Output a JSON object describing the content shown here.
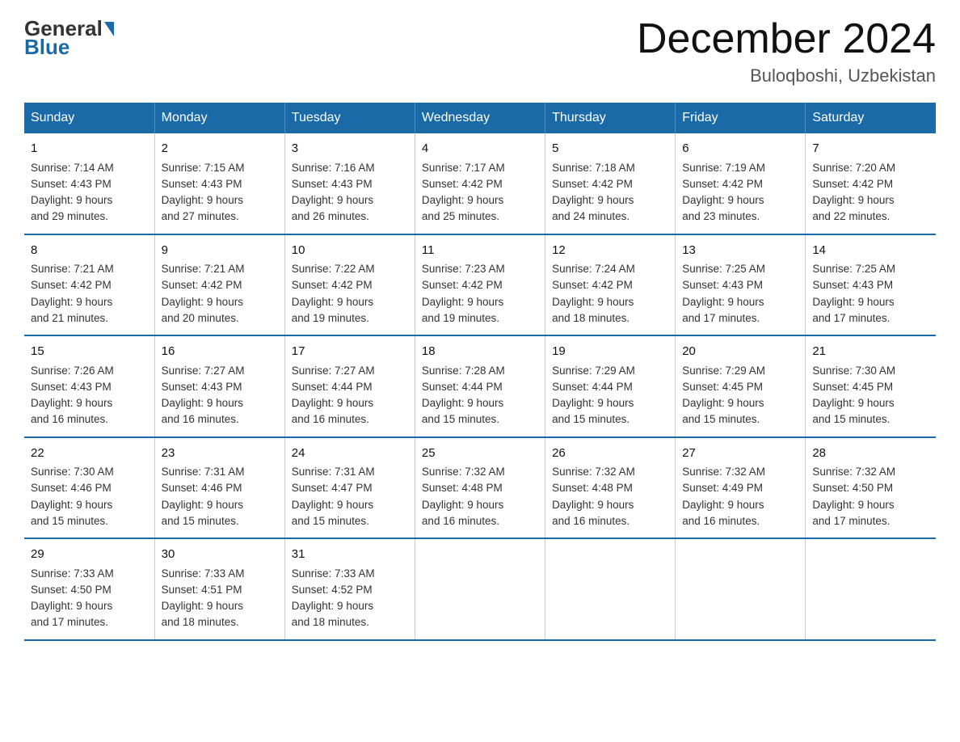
{
  "header": {
    "logo_general": "General",
    "logo_blue": "Blue",
    "title": "December 2024",
    "subtitle": "Buloqboshi, Uzbekistan"
  },
  "days_of_week": [
    "Sunday",
    "Monday",
    "Tuesday",
    "Wednesday",
    "Thursday",
    "Friday",
    "Saturday"
  ],
  "weeks": [
    [
      {
        "day": "1",
        "sunrise": "7:14 AM",
        "sunset": "4:43 PM",
        "daylight": "9 hours and 29 minutes."
      },
      {
        "day": "2",
        "sunrise": "7:15 AM",
        "sunset": "4:43 PM",
        "daylight": "9 hours and 27 minutes."
      },
      {
        "day": "3",
        "sunrise": "7:16 AM",
        "sunset": "4:43 PM",
        "daylight": "9 hours and 26 minutes."
      },
      {
        "day": "4",
        "sunrise": "7:17 AM",
        "sunset": "4:42 PM",
        "daylight": "9 hours and 25 minutes."
      },
      {
        "day": "5",
        "sunrise": "7:18 AM",
        "sunset": "4:42 PM",
        "daylight": "9 hours and 24 minutes."
      },
      {
        "day": "6",
        "sunrise": "7:19 AM",
        "sunset": "4:42 PM",
        "daylight": "9 hours and 23 minutes."
      },
      {
        "day": "7",
        "sunrise": "7:20 AM",
        "sunset": "4:42 PM",
        "daylight": "9 hours and 22 minutes."
      }
    ],
    [
      {
        "day": "8",
        "sunrise": "7:21 AM",
        "sunset": "4:42 PM",
        "daylight": "9 hours and 21 minutes."
      },
      {
        "day": "9",
        "sunrise": "7:21 AM",
        "sunset": "4:42 PM",
        "daylight": "9 hours and 20 minutes."
      },
      {
        "day": "10",
        "sunrise": "7:22 AM",
        "sunset": "4:42 PM",
        "daylight": "9 hours and 19 minutes."
      },
      {
        "day": "11",
        "sunrise": "7:23 AM",
        "sunset": "4:42 PM",
        "daylight": "9 hours and 19 minutes."
      },
      {
        "day": "12",
        "sunrise": "7:24 AM",
        "sunset": "4:42 PM",
        "daylight": "9 hours and 18 minutes."
      },
      {
        "day": "13",
        "sunrise": "7:25 AM",
        "sunset": "4:43 PM",
        "daylight": "9 hours and 17 minutes."
      },
      {
        "day": "14",
        "sunrise": "7:25 AM",
        "sunset": "4:43 PM",
        "daylight": "9 hours and 17 minutes."
      }
    ],
    [
      {
        "day": "15",
        "sunrise": "7:26 AM",
        "sunset": "4:43 PM",
        "daylight": "9 hours and 16 minutes."
      },
      {
        "day": "16",
        "sunrise": "7:27 AM",
        "sunset": "4:43 PM",
        "daylight": "9 hours and 16 minutes."
      },
      {
        "day": "17",
        "sunrise": "7:27 AM",
        "sunset": "4:44 PM",
        "daylight": "9 hours and 16 minutes."
      },
      {
        "day": "18",
        "sunrise": "7:28 AM",
        "sunset": "4:44 PM",
        "daylight": "9 hours and 15 minutes."
      },
      {
        "day": "19",
        "sunrise": "7:29 AM",
        "sunset": "4:44 PM",
        "daylight": "9 hours and 15 minutes."
      },
      {
        "day": "20",
        "sunrise": "7:29 AM",
        "sunset": "4:45 PM",
        "daylight": "9 hours and 15 minutes."
      },
      {
        "day": "21",
        "sunrise": "7:30 AM",
        "sunset": "4:45 PM",
        "daylight": "9 hours and 15 minutes."
      }
    ],
    [
      {
        "day": "22",
        "sunrise": "7:30 AM",
        "sunset": "4:46 PM",
        "daylight": "9 hours and 15 minutes."
      },
      {
        "day": "23",
        "sunrise": "7:31 AM",
        "sunset": "4:46 PM",
        "daylight": "9 hours and 15 minutes."
      },
      {
        "day": "24",
        "sunrise": "7:31 AM",
        "sunset": "4:47 PM",
        "daylight": "9 hours and 15 minutes."
      },
      {
        "day": "25",
        "sunrise": "7:32 AM",
        "sunset": "4:48 PM",
        "daylight": "9 hours and 16 minutes."
      },
      {
        "day": "26",
        "sunrise": "7:32 AM",
        "sunset": "4:48 PM",
        "daylight": "9 hours and 16 minutes."
      },
      {
        "day": "27",
        "sunrise": "7:32 AM",
        "sunset": "4:49 PM",
        "daylight": "9 hours and 16 minutes."
      },
      {
        "day": "28",
        "sunrise": "7:32 AM",
        "sunset": "4:50 PM",
        "daylight": "9 hours and 17 minutes."
      }
    ],
    [
      {
        "day": "29",
        "sunrise": "7:33 AM",
        "sunset": "4:50 PM",
        "daylight": "9 hours and 17 minutes."
      },
      {
        "day": "30",
        "sunrise": "7:33 AM",
        "sunset": "4:51 PM",
        "daylight": "9 hours and 18 minutes."
      },
      {
        "day": "31",
        "sunrise": "7:33 AM",
        "sunset": "4:52 PM",
        "daylight": "9 hours and 18 minutes."
      },
      null,
      null,
      null,
      null
    ]
  ],
  "labels": {
    "sunrise": "Sunrise:",
    "sunset": "Sunset:",
    "daylight": "Daylight:"
  }
}
